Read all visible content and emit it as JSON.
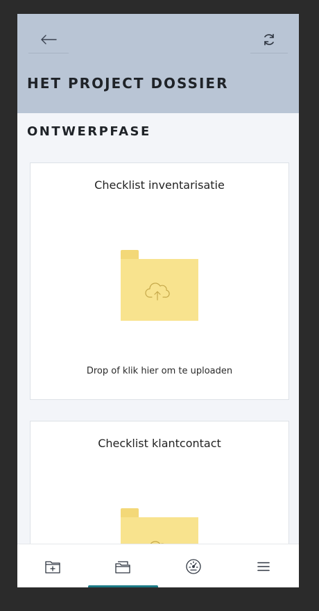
{
  "header": {
    "title": "HET PROJECT DOSSIER",
    "back_icon": "arrow-left-icon",
    "refresh_icon": "refresh-icon",
    "background": "#b9c5d5"
  },
  "section": {
    "title": "ONTWERPFASE"
  },
  "cards": [
    {
      "title": "Checklist inventarisatie",
      "hint": "Drop of klik hier om te uploaden",
      "icon": "folder-upload-icon"
    },
    {
      "title": "Checklist klantcontact",
      "icon": "folder-upload-icon"
    }
  ],
  "colors": {
    "folder": "#f8e38e",
    "folder_tab": "#f3d878",
    "accent": "#1c7b86"
  },
  "bottom_nav": {
    "items": [
      {
        "icon": "folder-add-icon"
      },
      {
        "icon": "folder-files-icon",
        "active": true
      },
      {
        "icon": "dashboard-gauge-icon"
      },
      {
        "icon": "menu-icon"
      }
    ]
  }
}
